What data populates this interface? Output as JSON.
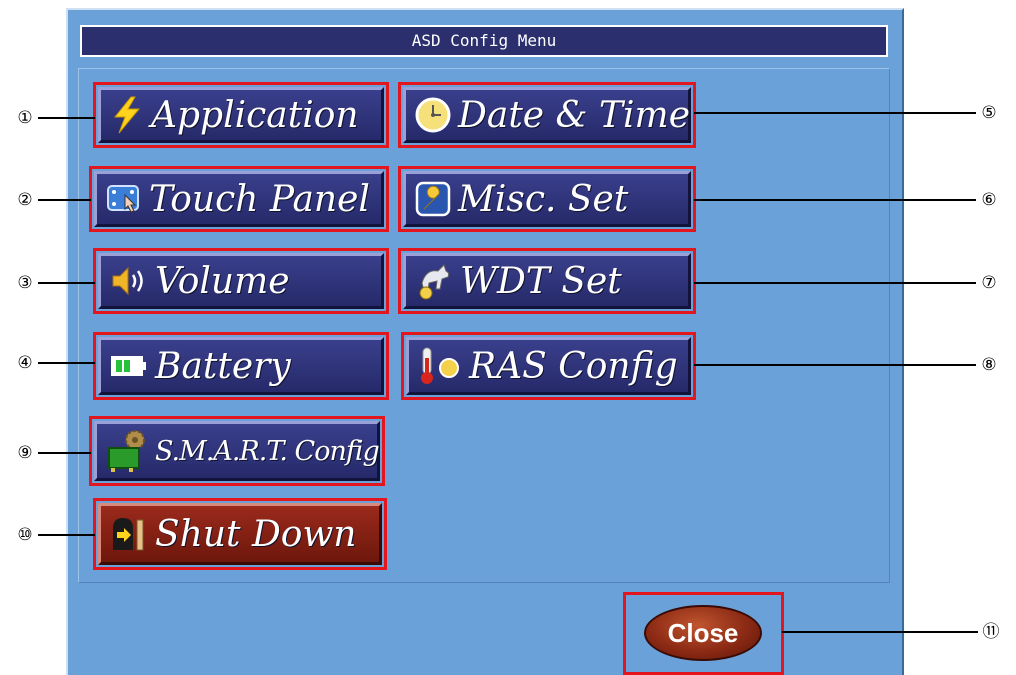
{
  "window": {
    "title": "ASD Config Menu"
  },
  "buttons": {
    "application": {
      "label": "Application",
      "icon": "lightning-icon"
    },
    "touch_panel": {
      "label": "Touch Panel",
      "icon": "touch-panel-icon"
    },
    "volume": {
      "label": "Volume",
      "icon": "speaker-icon"
    },
    "battery": {
      "label": "Battery",
      "icon": "battery-icon"
    },
    "smart_config": {
      "label": "S.M.A.R.T. Config",
      "icon": "disk-gear-icon"
    },
    "shut_down": {
      "label": "Shut Down",
      "icon": "exit-door-icon"
    },
    "date_time": {
      "label": "Date & Time",
      "icon": "clock-icon"
    },
    "misc_set": {
      "label": "Misc. Set",
      "icon": "wrench-icon"
    },
    "wdt_set": {
      "label": "WDT Set",
      "icon": "watchdog-icon"
    },
    "ras_config": {
      "label": "RAS Config",
      "icon": "thermometer-icon"
    },
    "close": {
      "label": "Close"
    }
  },
  "callouts": [
    "①",
    "②",
    "③",
    "④",
    "⑤",
    "⑥",
    "⑦",
    "⑧",
    "⑨",
    "⑩",
    "⑪"
  ],
  "colors": {
    "panel": "#69a1d8",
    "title_bar": "#2b2f6e",
    "button_face": "#2e3278",
    "shutdown_face": "#7e1f12",
    "highlight_border": "#e3161e"
  }
}
